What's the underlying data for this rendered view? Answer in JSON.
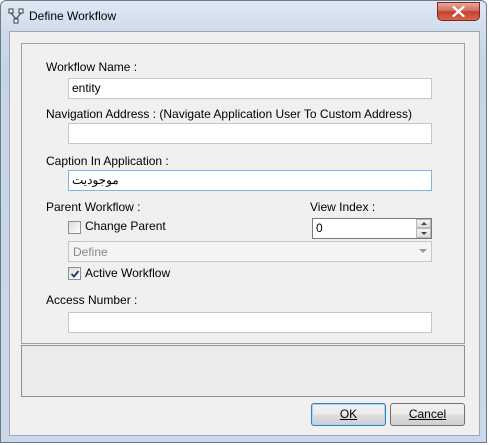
{
  "window": {
    "title": "Define Workflow"
  },
  "form": {
    "workflow_name_label": "Workflow Name :",
    "workflow_name_value": "entity",
    "navigation_address_label": "Navigation Address : (Navigate Application User To Custom Address)",
    "navigation_address_value": "",
    "caption_label": "Caption In Application :",
    "caption_value": "موجودیت",
    "parent_workflow_label": "Parent Workflow :",
    "change_parent_label": "Change Parent",
    "change_parent_checked": false,
    "parent_select_value": "Define",
    "active_workflow_label": "Active Workflow",
    "active_workflow_checked": true,
    "view_index_label": "View Index :",
    "view_index_value": "0",
    "access_number_label": "Access Number :",
    "access_number_value": ""
  },
  "buttons": {
    "ok": "OK",
    "cancel": "Cancel"
  },
  "icons": {
    "title": "workflow-icon",
    "close": "close-icon",
    "check": "checkmark-icon",
    "dropdown": "chevron-down-icon"
  },
  "colors": {
    "close_button": "#c2422d",
    "focus_border": "#7eb4ea",
    "default_button_border": "#3c7fb1"
  }
}
